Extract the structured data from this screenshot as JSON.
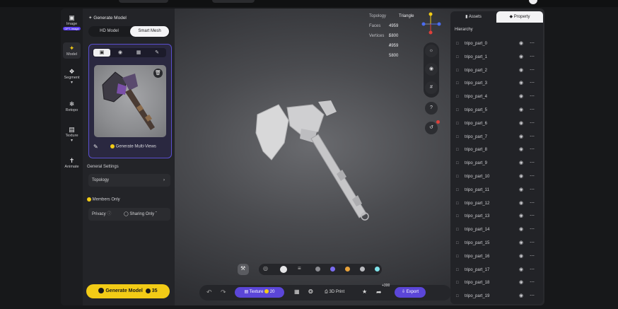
{
  "rail": {
    "items": [
      {
        "label": "Image",
        "badge": "GPT-Image",
        "icon": "image-icon"
      },
      {
        "label": "Model",
        "icon": "sparkle-icon"
      },
      {
        "label": "Segment",
        "icon": "segment-cube-icon"
      },
      {
        "label": "Retopo",
        "icon": "retopo-icon"
      },
      {
        "label": "Texture",
        "icon": "texture-icon"
      },
      {
        "label": "Animate",
        "icon": "animate-figure-icon"
      }
    ]
  },
  "left_panel": {
    "title": "Generate Model",
    "mode_options": [
      "HD Model",
      "Smart Mesh"
    ],
    "selected_mode": "Smart Mesh",
    "card_tabs": [
      "image-tab-icon",
      "cube-tab-icon",
      "gallery-tab-icon",
      "pen-tab-icon"
    ],
    "generate_multiviews": "Generate Multi-Views",
    "general_settings": "General Settings",
    "topology_label": "Topology",
    "members_only": "Members Only",
    "privacy_label": "Privacy",
    "sharing_label": "Sharing Only",
    "generate_button": "Generate Model",
    "generate_cost": "35"
  },
  "stats": {
    "topology_label": "Topology",
    "topology_value": "Triangle",
    "faces_label": "Faces",
    "faces_value": "4959 / 4959",
    "vertices_label": "Vertices",
    "vertices_value": "5800 / 5800"
  },
  "right_panel": {
    "tabs": [
      "Assets",
      "Property"
    ],
    "active_tab": "Property",
    "hierarchy_title": "Hierarchy",
    "parts": [
      "tripo_part_0",
      "tripo_part_1",
      "tripo_part_2",
      "tripo_part_3",
      "tripo_part_4",
      "tripo_part_5",
      "tripo_part_6",
      "tripo_part_7",
      "tripo_part_8",
      "tripo_part_9",
      "tripo_part_10",
      "tripo_part_11",
      "tripo_part_12",
      "tripo_part_13",
      "tripo_part_14",
      "tripo_part_15",
      "tripo_part_16",
      "tripo_part_17",
      "tripo_part_18",
      "tripo_part_19"
    ]
  },
  "bottom": {
    "texture_label": "Texture",
    "texture_cost": "20",
    "print_label": "3D Print",
    "plus_badge": "+300",
    "export_label": "Export",
    "material_colors": [
      "#8a8b90",
      "#7a6cf0",
      "#e8a23a",
      "#b9babe",
      "#7fe3ea"
    ]
  },
  "colors": {
    "accent": "#5b46d8",
    "cta": "#f2cb16",
    "panel": "#232428"
  }
}
